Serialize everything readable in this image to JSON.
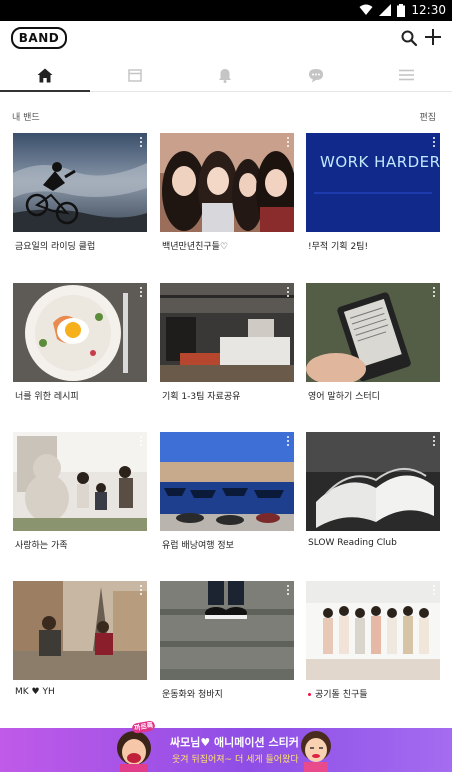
{
  "status_bar": {
    "time": "12:30"
  },
  "app": {
    "logo_text": "BAND"
  },
  "tabs": [
    {
      "name": "home",
      "icon": "home-icon",
      "active": true
    },
    {
      "name": "feed",
      "icon": "feed-icon",
      "active": false
    },
    {
      "name": "notifications",
      "icon": "bell-icon",
      "active": false
    },
    {
      "name": "chat",
      "icon": "chat-icon",
      "active": false
    },
    {
      "name": "menu",
      "icon": "menu-icon",
      "active": false
    }
  ],
  "section": {
    "title": "내 밴드",
    "edit_label": "편집"
  },
  "bands": [
    {
      "name": "금요일의 라이딩 클럽",
      "new": false
    },
    {
      "name": "백년만년친구들♡",
      "new": false
    },
    {
      "name": "!무적 기획 2팀!",
      "new": false
    },
    {
      "name": "너를 위한 레시피",
      "new": false
    },
    {
      "name": "기획 1-3팀 자료공유",
      "new": false
    },
    {
      "name": "영어 말하기 스터디",
      "new": false
    },
    {
      "name": "사랑하는 가족",
      "new": false
    },
    {
      "name": "유럽 배낭여행 정보",
      "new": false
    },
    {
      "name": "SLOW Reading Club",
      "new": false
    },
    {
      "name": "MK ♥ YH",
      "new": false
    },
    {
      "name": "운동화와 청바지",
      "new": false
    },
    {
      "name": "공기돌 친구들",
      "new": true
    }
  ],
  "thumb_texts": {
    "neon_sign": "WORK HARDER"
  },
  "banner": {
    "title": "싸모님♥ 애니메이션 스티커",
    "subtitle": "웃겨 뒤집어져~ 더 세게 들어왔다",
    "badge": "까르륵"
  },
  "colors": {
    "new_dot": "#e11144",
    "banner_purple": "#9c52e8",
    "banner_yellow": "#ffe46a"
  }
}
